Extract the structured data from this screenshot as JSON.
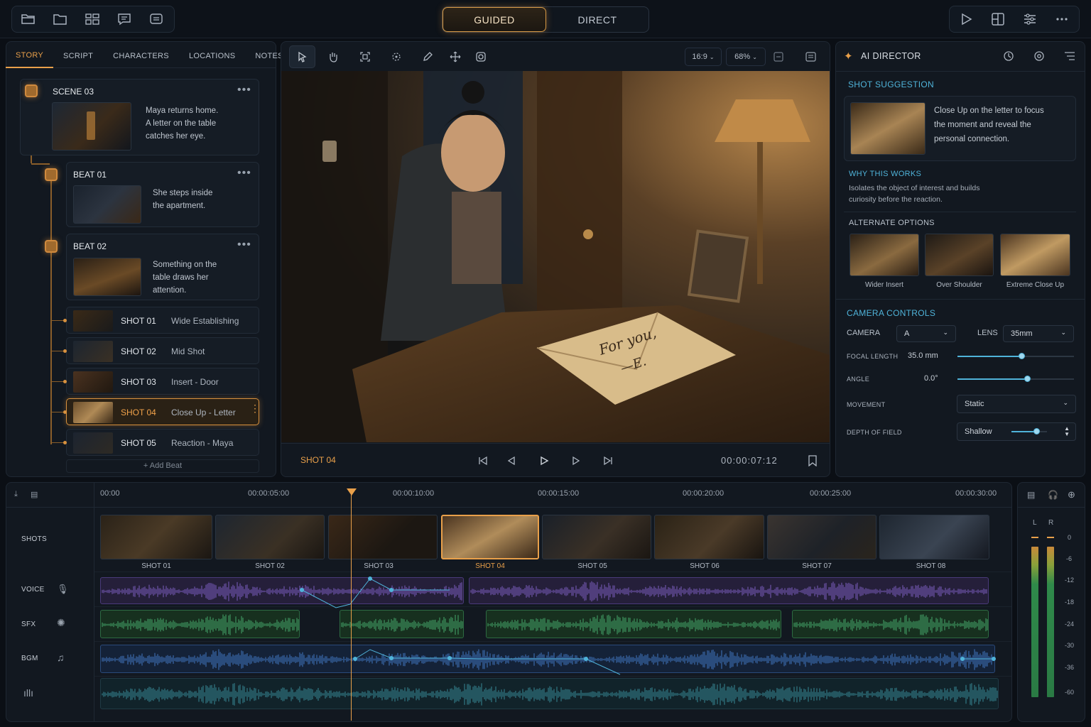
{
  "topbar": {
    "modes": [
      "GUIDED",
      "DIRECT"
    ],
    "active_mode": "GUIDED",
    "left_icons": [
      "folder-open-icon",
      "folder-icon",
      "layout-grid-icon",
      "chat-icon",
      "comment-icon"
    ],
    "right_icons": [
      "play-icon",
      "layout-panels-icon",
      "sliders-icon",
      "more-icon"
    ]
  },
  "story_tabs": [
    "STORY",
    "SCRIPT",
    "CHARACTERS",
    "LOCATIONS",
    "NOTES"
  ],
  "scene": {
    "title": "SCENE 03",
    "description": [
      "Maya returns home.",
      "A letter on the table",
      "catches her eye."
    ]
  },
  "beats": [
    {
      "title": "BEAT 01",
      "description": [
        "She steps inside",
        "the apartment."
      ]
    },
    {
      "title": "BEAT 02",
      "description": [
        "Something on the",
        "table draws her",
        "attention."
      ]
    }
  ],
  "shots": [
    {
      "id": "SHOT 01",
      "name": "Wide Establishing"
    },
    {
      "id": "SHOT 02",
      "name": "Mid Shot"
    },
    {
      "id": "SHOT 03",
      "name": "Insert - Door"
    },
    {
      "id": "SHOT 04",
      "name": "Close Up - Letter"
    },
    {
      "id": "SHOT 05",
      "name": "Reaction - Maya"
    }
  ],
  "selected_shot": "SHOT 04",
  "add_beat": "Add Beat",
  "viewer": {
    "aspect": "16:9",
    "zoom": "68%",
    "current_shot": "SHOT 04",
    "timecode": "00:00:07:12",
    "letter_text": [
      "For you,",
      "—E."
    ],
    "tools": [
      "select-tool-icon",
      "hand-tool-icon",
      "frame-tool-icon",
      "transform-tool-icon",
      "pen-tool-icon",
      "move-tool-icon",
      "camera-tool-icon"
    ]
  },
  "ai": {
    "title": "AI DIRECTOR",
    "suggestion_title": "SHOT SUGGESTION",
    "suggestion_text": [
      "Close Up on the letter to focus",
      "the moment and reveal the",
      "personal connection."
    ],
    "why_title": "WHY THIS WORKS",
    "why_text": [
      "Isolates the object of interest and builds",
      "curiosity before the reaction."
    ],
    "alt_title": "ALTERNATE OPTIONS",
    "alternates": [
      "Wider Insert",
      "Over Shoulder",
      "Extreme Close Up"
    ]
  },
  "camera": {
    "title": "CAMERA CONTROLS",
    "camera_label": "CAMERA",
    "camera_value": "A",
    "lens_label": "LENS",
    "lens_value": "35mm",
    "focal_label": "FOCAL LENGTH",
    "focal_value": "35.0 mm",
    "focal_level": 0.55,
    "angle_label": "ANGLE",
    "angle_value": "0.0°",
    "angle_level": 0.6,
    "movement_label": "MOVEMENT",
    "movement_value": "Static",
    "dof_label": "DEPTH OF FIELD",
    "dof_value": "Shallow",
    "dof_level": 0.7
  },
  "timeline": {
    "ticks": [
      "00:00",
      "00:00:05:00",
      "00:00:10:00",
      "00:00:15:00",
      "00:00:20:00",
      "00:00:25:00",
      "00:00:30:00"
    ],
    "tracks": [
      "SHOTS",
      "VOICE",
      "SFX",
      "BGM"
    ],
    "shot_frames": [
      "SHOT 01",
      "SHOT 02",
      "SHOT 03",
      "SHOT 04",
      "SHOT 05",
      "SHOT 06",
      "SHOT 07",
      "SHOT 08"
    ],
    "active_frame": "SHOT 04",
    "colors": {
      "voice": "#7d5fd0",
      "sfx": "#3fa86a",
      "bgm": "#3e72c8",
      "accent": "#e9a04a",
      "cyan": "#4fb3d9"
    }
  },
  "meter": {
    "channels": [
      "L",
      "R"
    ],
    "scale": [
      "0",
      "-6",
      "-12",
      "-18",
      "-24",
      "-30",
      "-36",
      "-60"
    ]
  }
}
